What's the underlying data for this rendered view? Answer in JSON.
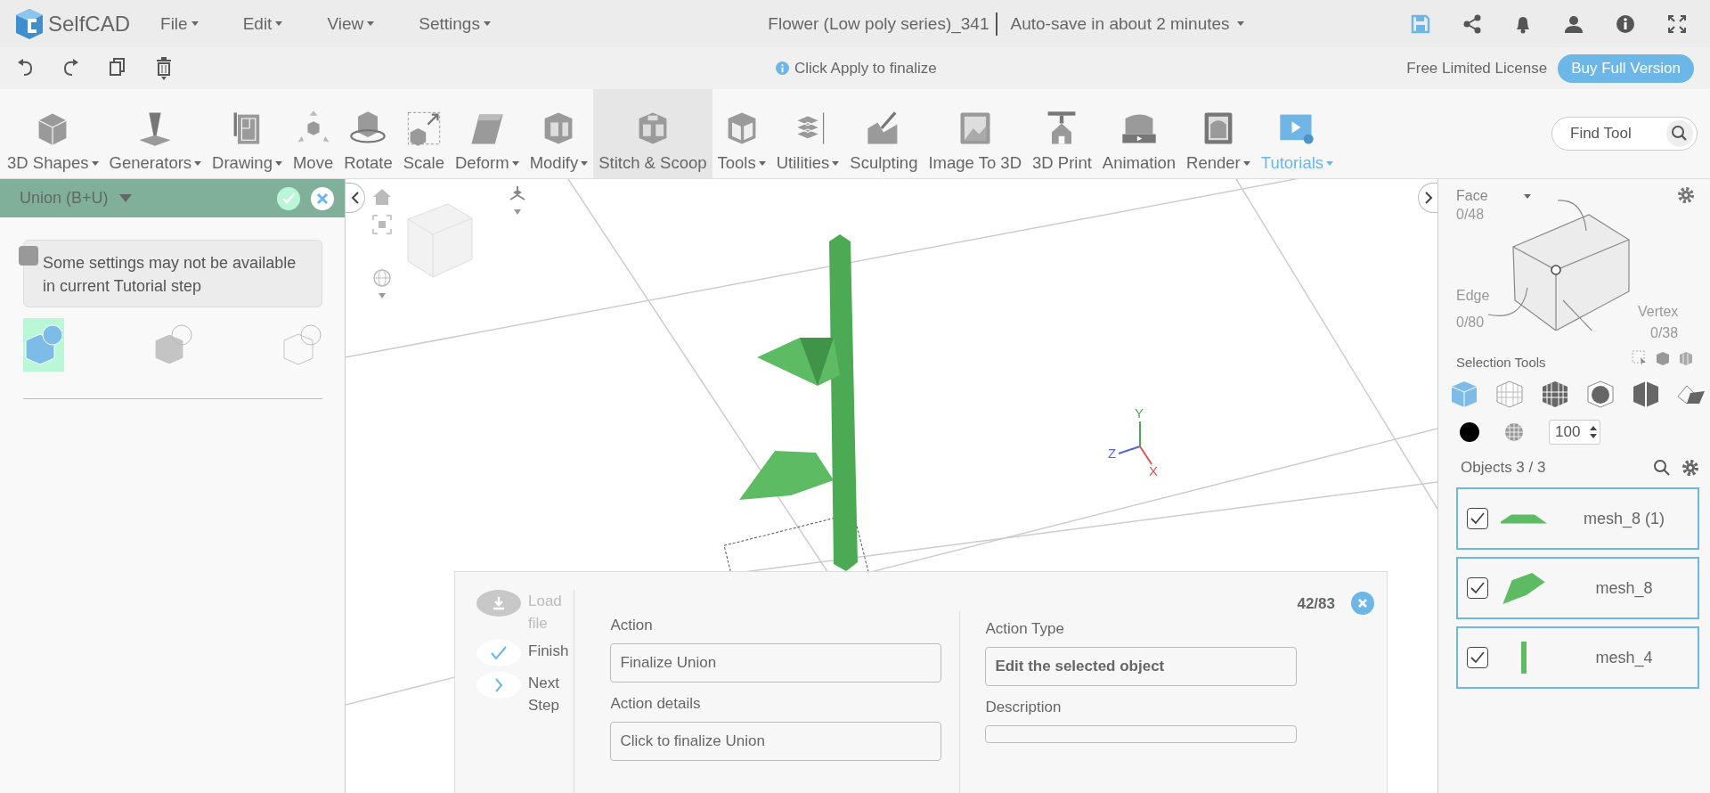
{
  "app": {
    "logo": "SelfCAD"
  },
  "menu": [
    {
      "label": "File"
    },
    {
      "label": "Edit"
    },
    {
      "label": "View"
    },
    {
      "label": "Settings"
    }
  ],
  "document": {
    "title": "Flower (Low poly series)_341",
    "autosave": "Auto-save in about 2 minutes"
  },
  "action_bar": {
    "hint": "Click Apply to finalize",
    "license": "Free Limited License",
    "buy_button": "Buy Full Version"
  },
  "toolbar": {
    "tools": [
      {
        "label": "3D Shapes",
        "dropdown": true,
        "selected": false,
        "accent": false
      },
      {
        "label": "Generators",
        "dropdown": true,
        "selected": false,
        "accent": false
      },
      {
        "label": "Drawing",
        "dropdown": true,
        "selected": false,
        "accent": false
      },
      {
        "label": "Move",
        "dropdown": false,
        "selected": false,
        "accent": false
      },
      {
        "label": "Rotate",
        "dropdown": false,
        "selected": false,
        "accent": false
      },
      {
        "label": "Scale",
        "dropdown": false,
        "selected": false,
        "accent": false
      },
      {
        "label": "Deform",
        "dropdown": true,
        "selected": false,
        "accent": false
      },
      {
        "label": "Modify",
        "dropdown": true,
        "selected": false,
        "accent": false
      },
      {
        "label": "Stitch & Scoop",
        "dropdown": false,
        "selected": true,
        "accent": false
      },
      {
        "label": "Tools",
        "dropdown": true,
        "selected": false,
        "accent": false
      },
      {
        "label": "Utilities",
        "dropdown": true,
        "selected": false,
        "accent": false
      },
      {
        "label": "Sculpting",
        "dropdown": false,
        "selected": false,
        "accent": false
      },
      {
        "label": "Image To 3D",
        "dropdown": false,
        "selected": false,
        "accent": false
      },
      {
        "label": "3D Print",
        "dropdown": false,
        "selected": false,
        "accent": false
      },
      {
        "label": "Animation",
        "dropdown": false,
        "selected": false,
        "accent": false
      },
      {
        "label": "Render",
        "dropdown": true,
        "selected": false,
        "accent": false
      },
      {
        "label": "Tutorials",
        "dropdown": true,
        "selected": false,
        "accent": true
      }
    ],
    "search": {
      "placeholder": "Find Tool"
    }
  },
  "tool_panel": {
    "title": "Union (B+U)",
    "notice": "Some settings may not be available in current Tutorial step",
    "modes": [
      {
        "selected": true
      },
      {
        "selected": false
      },
      {
        "selected": false
      }
    ]
  },
  "viewport": {
    "axes": [
      "Y",
      "Z",
      "X"
    ]
  },
  "tutorial": {
    "steps": [
      {
        "label": "Load file",
        "kind": "load",
        "disabled": true
      },
      {
        "label": "Finish",
        "kind": "finish",
        "disabled": false
      },
      {
        "label": "Next Step",
        "kind": "next",
        "disabled": false
      }
    ],
    "counter": "42/83",
    "action_label": "Action",
    "action": "Finalize Union",
    "details_label": "Action details",
    "details": "Click to finalize Union",
    "type_label": "Action Type",
    "type": "Edit the selected object",
    "description_label": "Description"
  },
  "selection": {
    "mode": "Face",
    "face_count": "0/48",
    "edge_label": "Edge",
    "edge_count": "0/80",
    "vertex_label": "Vertex",
    "vertex_count": "0/38",
    "tools_label": "Selection Tools",
    "modes": [
      {
        "selected": true
      },
      {
        "selected": false
      },
      {
        "selected": false
      },
      {
        "selected": false
      },
      {
        "selected": false
      },
      {
        "selected": false
      }
    ],
    "opacity": "100"
  },
  "objects": {
    "title": "Objects 3 / 3",
    "items": [
      {
        "name": "mesh_8 (1)",
        "checked": true
      },
      {
        "name": "mesh_8",
        "checked": true
      },
      {
        "name": "mesh_4",
        "checked": true
      }
    ]
  }
}
